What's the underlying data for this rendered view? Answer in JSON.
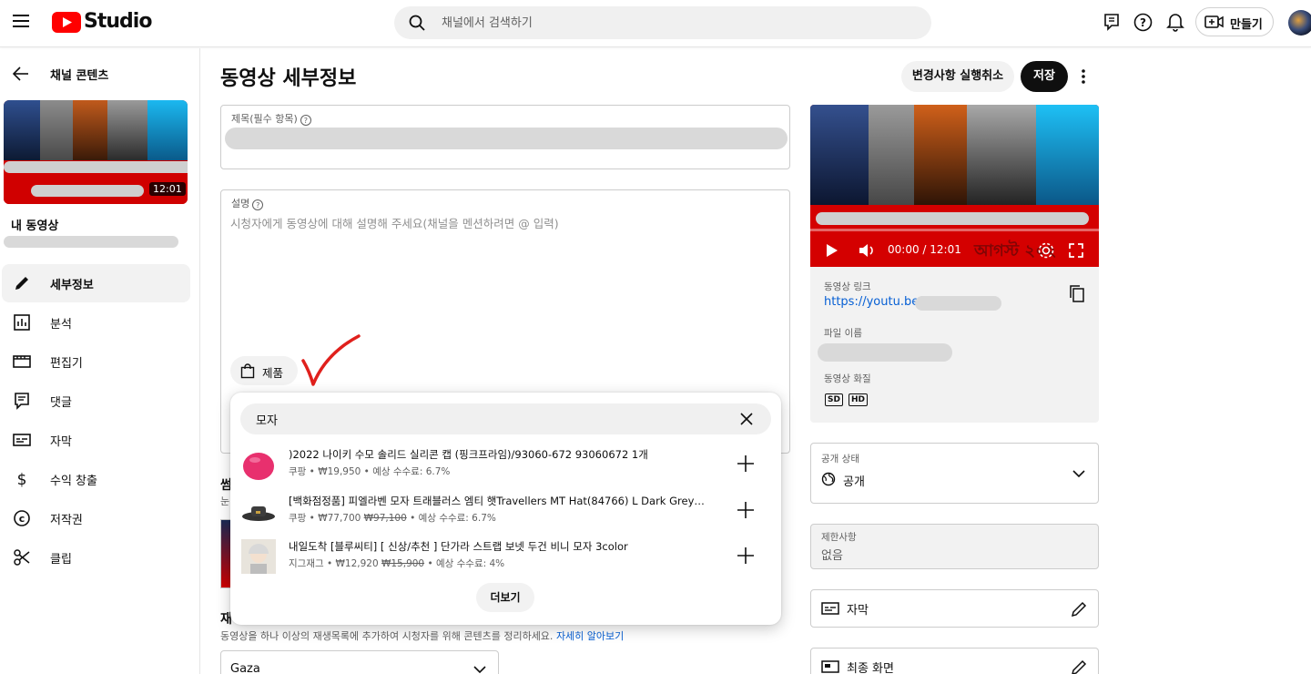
{
  "app": {
    "name": "Studio"
  },
  "header": {
    "search_placeholder": "채널에서 검색하기",
    "create_label": "만들기"
  },
  "sidebar": {
    "back_label": "채널 콘텐츠",
    "thumb_duration": "12:01",
    "my_video_label": "내 동영상",
    "items": [
      {
        "label": "세부정보",
        "icon": "pencil-icon",
        "active": true
      },
      {
        "label": "분석",
        "icon": "analytics-icon"
      },
      {
        "label": "편집기",
        "icon": "editor-icon"
      },
      {
        "label": "댓글",
        "icon": "comments-icon"
      },
      {
        "label": "자막",
        "icon": "subtitles-icon"
      },
      {
        "label": "수익 창출",
        "icon": "dollar-icon"
      },
      {
        "label": "저작권",
        "icon": "copyright-icon"
      },
      {
        "label": "클립",
        "icon": "scissors-icon"
      }
    ]
  },
  "main": {
    "title": "동영상 세부정보",
    "undo_label": "변경사항 실행취소",
    "save_label": "저장",
    "title_field_label": "제목(필수 항목)",
    "desc_field_label": "설명",
    "desc_placeholder": "시청자에게 동영상에 대해 설명해 주세요(채널을 멘션하려면 @ 입력)",
    "products_chip": "제품",
    "thumb_section_partial": "썸",
    "thumb_sub_partial": "눈",
    "playlist_section_partial": "재",
    "playlist_desc": "동영상을 하나 이상의 재생목록에 추가하여 시청자를 위해 콘텐츠를 정리하세요.",
    "playlist_learn_more": "자세히 알아보기",
    "playlist_value": "Gaza"
  },
  "product_popup": {
    "query": "모자",
    "more_label": "더보기",
    "products": [
      {
        "name": ")2022 나이키 수모 솔리드 실리콘 캡 (핑크프라임)/93060-672 93060672 1개",
        "store": "쿠팡",
        "price": "₩19,950",
        "old_price": "",
        "commission": "예상 수수료: 6.7%"
      },
      {
        "name": "[백화점정품] 피엘라벤 모자 트래블러스 엠티 햇Travellers MT Hat(84766) L Dark Grey Dar...",
        "store": "쿠팡",
        "price": "₩77,700",
        "old_price": "₩97,100",
        "commission": "예상 수수료: 6.7%"
      },
      {
        "name": "내일도착 [블루씨티] [ 신상/추천 ] 단가라 스트랩 보넷 두건 비니 모자 3color",
        "store": "지그재그",
        "price": "₩12,920",
        "old_price": "₩15,900",
        "commission": "예상 수수료: 4%"
      }
    ]
  },
  "right": {
    "player_time": "00:00 / 12:01",
    "player_overlay_text": "আগস্ট ২০২",
    "video_link_label": "동영상 링크",
    "video_link": "https://youtu.be/",
    "filename_label": "파일 이름",
    "quality_label": "동영상 화질",
    "quality_badges": [
      "SD",
      "HD"
    ],
    "visibility_label": "공개 상태",
    "visibility_value": "공개",
    "restrictions_label": "제한사항",
    "restrictions_value": "없음",
    "subtitles_label": "자막",
    "end_screen_label": "최종 화면"
  },
  "colors": {
    "accent": "#065fd4",
    "youtube_red": "#ff0000",
    "annotation_red": "#e0201c"
  }
}
